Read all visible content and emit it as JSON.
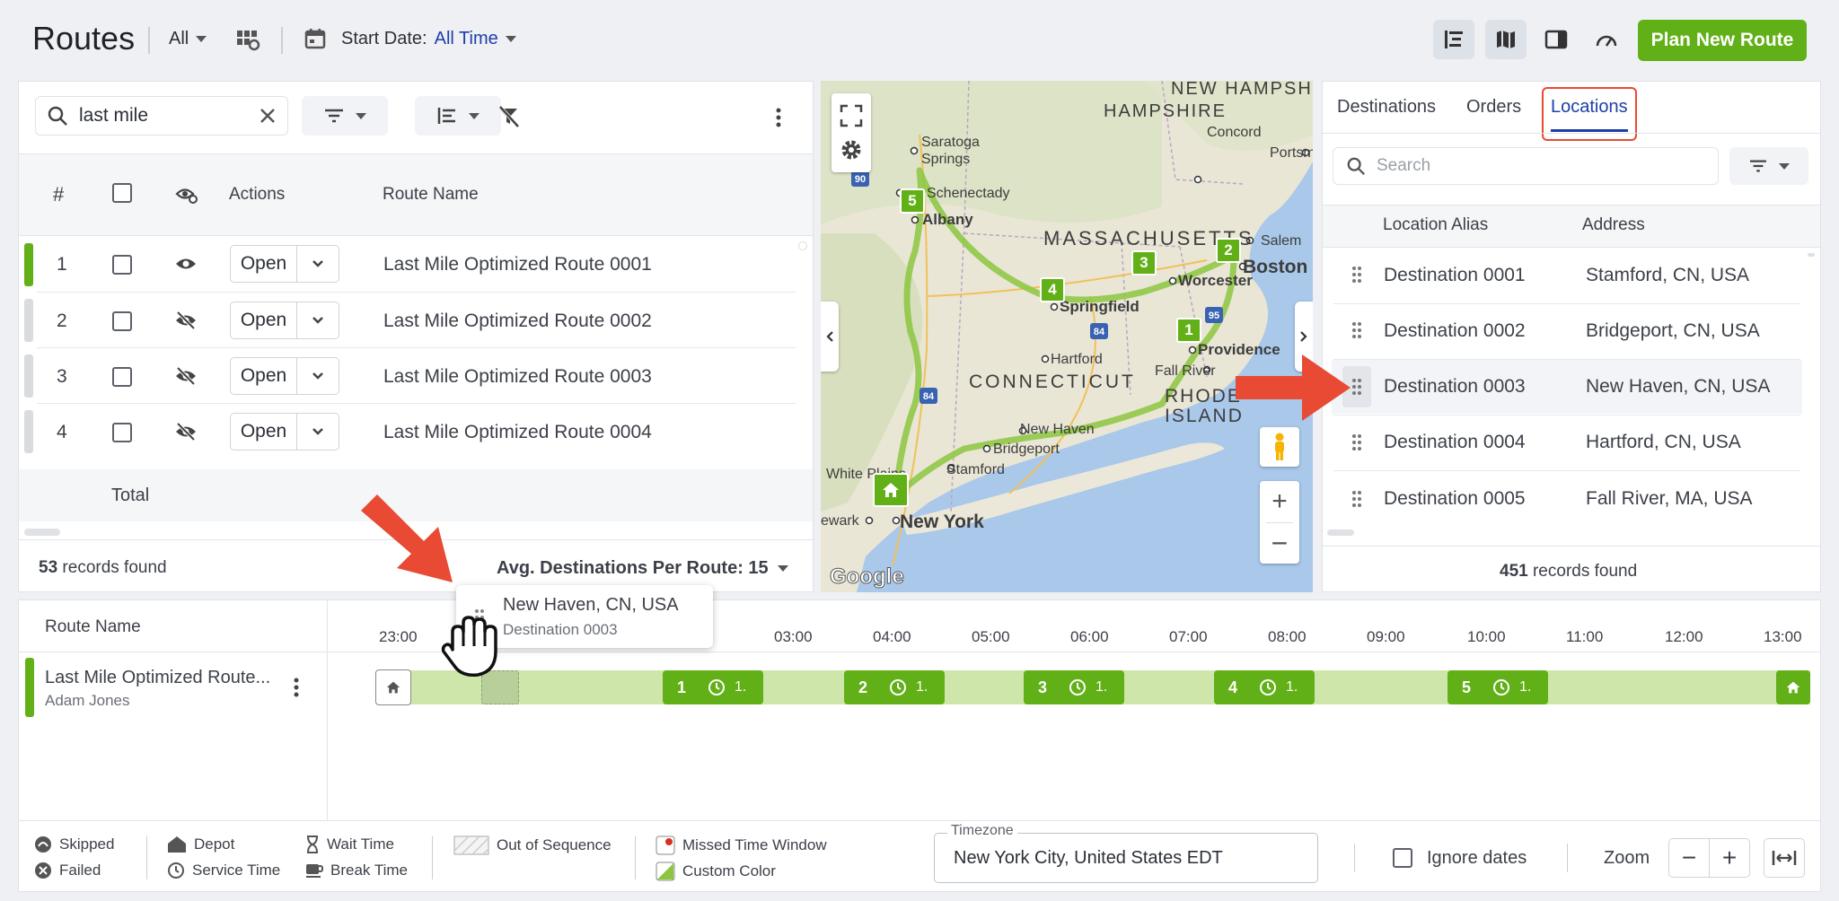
{
  "header": {
    "title": "Routes",
    "filter_value": "All",
    "start_date_label": "Start Date:",
    "start_date_value": "All Time",
    "plan_button": "Plan New Route"
  },
  "routes_panel": {
    "search_value": "last mile",
    "columns": [
      "#",
      "Actions",
      "Route Name"
    ],
    "rows": [
      {
        "num": "1",
        "action": "Open",
        "name": "Last Mile Optimized Route 0001",
        "visible": true,
        "color": "#62b017"
      },
      {
        "num": "2",
        "action": "Open",
        "name": "Last Mile Optimized Route 0002",
        "visible": false,
        "color": "#d9dbde"
      },
      {
        "num": "3",
        "action": "Open",
        "name": "Last Mile Optimized Route 0003",
        "visible": false,
        "color": "#d9dbde"
      },
      {
        "num": "4",
        "action": "Open",
        "name": "Last Mile Optimized Route 0004",
        "visible": false,
        "color": "#d9dbde"
      }
    ],
    "total_label": "Total",
    "records_count": "53",
    "records_suffix": "records found",
    "avg_label": "Avg. Destinations Per Route: 15"
  },
  "map": {
    "labels": {
      "nh": "NEW HAMPSHIRE",
      "nh2": "HAMPSHIRE",
      "concord": "Concord",
      "saratoga": "Saratoga",
      "springs": "Springs",
      "schenectady": "Schenectady",
      "albany": "Albany",
      "mass": "MASSACHUSETTS",
      "salem": "Salem",
      "boston": "Boston",
      "worcester": "Worcester",
      "springfield": "Springfield",
      "providence": "Providence",
      "hartford": "Hartford",
      "ct": "CONNECTICUT",
      "fallriver": "Fall River",
      "rhode": "RHODE",
      "island": "ISLAND",
      "newhaven": "New Haven",
      "bridgeport": "Bridgeport",
      "stamford": "Stamford",
      "whiteplains": "White Plains",
      "newark": "ewark",
      "newyork": "New York",
      "portsm": "Portsm",
      "google": "Google"
    },
    "route_color": "#8cc63f",
    "pin_color": "#62b017"
  },
  "locations_panel": {
    "tabs": [
      "Destinations",
      "Orders",
      "Locations"
    ],
    "active_tab": "Locations",
    "search_placeholder": "Search",
    "columns": [
      "Location Alias",
      "Address"
    ],
    "rows": [
      {
        "alias": "Destination 0001",
        "address": "Stamford, CN, USA"
      },
      {
        "alias": "Destination 0002",
        "address": "Bridgeport, CN, USA"
      },
      {
        "alias": "Destination 0003",
        "address": "New Haven, CN, USA"
      },
      {
        "alias": "Destination 0004",
        "address": "Hartford, CN, USA"
      },
      {
        "alias": "Destination 0005",
        "address": "Fall River, MA, USA"
      }
    ],
    "records_count": "451",
    "records_suffix": "records found"
  },
  "drag_tooltip": {
    "address": "New Haven, CN, USA",
    "alias": "Destination 0003"
  },
  "timeline": {
    "column_header": "Route Name",
    "route_name": "Last Mile Optimized Route...",
    "driver": "Adam Jones",
    "ticks": [
      "23:00",
      "03:00",
      "04:00",
      "05:00",
      "06:00",
      "07:00",
      "08:00",
      "09:00",
      "10:00",
      "11:00",
      "12:00",
      "13:00"
    ],
    "stops": [
      {
        "num": "1",
        "trail": "1."
      },
      {
        "num": "2",
        "trail": "1."
      },
      {
        "num": "3",
        "trail": "1."
      },
      {
        "num": "4",
        "trail": "1."
      },
      {
        "num": "5",
        "trail": "1."
      }
    ]
  },
  "legend": {
    "skipped": "Skipped",
    "failed": "Failed",
    "depot": "Depot",
    "service_time": "Service Time",
    "wait_time": "Wait Time",
    "break_time": "Break Time",
    "out_of_sequence": "Out of Sequence",
    "missed_window": "Missed Time Window",
    "custom_color": "Custom Color"
  },
  "footer": {
    "timezone_label": "Timezone",
    "timezone_value": "New York City, United States EDT",
    "ignore_dates": "Ignore dates",
    "zoom_label": "Zoom"
  },
  "colors": {
    "accent_blue": "#1e3fa8",
    "brand_green": "#62b017",
    "arrow_red": "#e84a33",
    "highlight_red": "#e84a33"
  }
}
